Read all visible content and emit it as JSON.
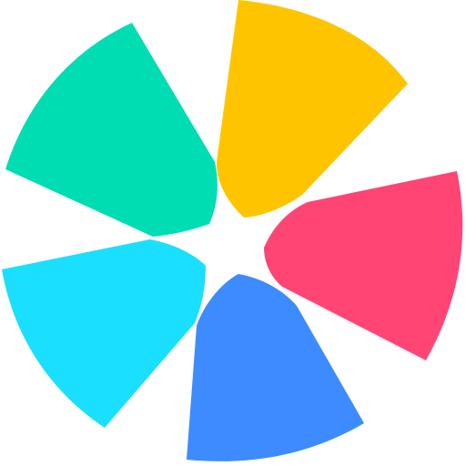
{
  "icon": {
    "name": "pinwheel-logo-icon",
    "petals": [
      {
        "name": "petal-yellow",
        "color": "#FFC400"
      },
      {
        "name": "petal-pink",
        "color": "#FF4574"
      },
      {
        "name": "petal-blue",
        "color": "#3D8BFF"
      },
      {
        "name": "petal-cyan",
        "color": "#1ADFFF"
      },
      {
        "name": "petal-green",
        "color": "#00DDB3"
      }
    ]
  }
}
